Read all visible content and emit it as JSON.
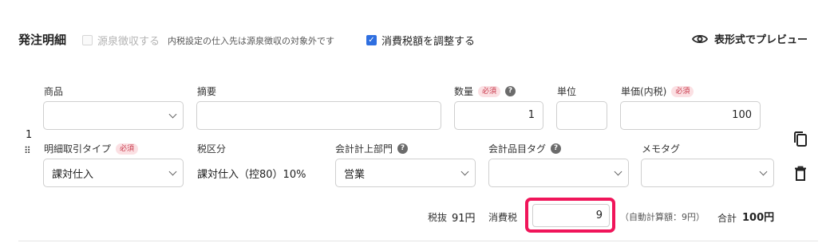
{
  "header": {
    "title": "発注明細",
    "withholding_label": "源泉徴収する",
    "withholding_note": "内税設定の仕入先は源泉徴収の対象外です",
    "withholding_checked": false,
    "adjust_tax_label": "消費税額を調整する",
    "adjust_tax_checked": true,
    "preview_label": "表形式でプレビュー"
  },
  "required_badge": "必須",
  "help_glyph": "?",
  "row": {
    "number": "1",
    "product": {
      "label": "商品",
      "value": ""
    },
    "summary": {
      "label": "摘要",
      "value": ""
    },
    "quantity": {
      "label": "数量",
      "value": "1"
    },
    "unit": {
      "label": "単位",
      "value": ""
    },
    "unit_price": {
      "label": "単価(内税)",
      "value": "100"
    },
    "transaction_type": {
      "label": "明細取引タイプ",
      "value": "課対仕入"
    },
    "tax_category": {
      "label": "税区分",
      "value": "課対仕入（控80）10%"
    },
    "department": {
      "label": "会計計上部門",
      "value": "営業"
    },
    "account_tag": {
      "label": "会計品目タグ",
      "value": ""
    },
    "memo_tag": {
      "label": "メモタグ",
      "value": ""
    }
  },
  "totals": {
    "excl_tax_label": "税抜",
    "excl_tax_value": "91円",
    "tax_label": "消費税",
    "tax_value": "9",
    "auto_calc_note": "（自動計算額：9円）",
    "total_label": "合計",
    "total_value": "100円"
  },
  "colors": {
    "accent": "#2f6fe0",
    "highlight": "#f0155a",
    "required_bg": "#fbe0e3",
    "required_text": "#c8374a"
  },
  "icons": [
    "eye-icon",
    "copy-icon",
    "trash-icon",
    "drag-handle-icon",
    "help-icon",
    "chevron-down-icon"
  ]
}
